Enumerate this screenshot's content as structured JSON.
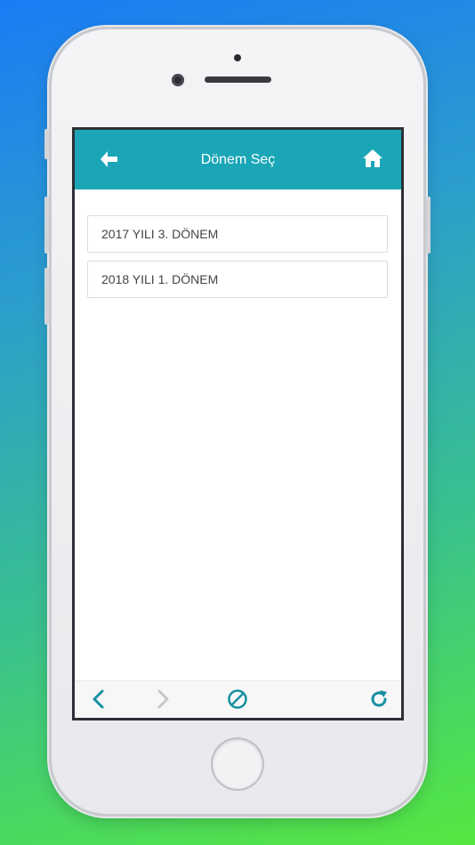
{
  "header": {
    "title": "Dönem Seç",
    "back_icon": "arrow-left-icon",
    "home_icon": "home-icon"
  },
  "periods": [
    {
      "label": "2017 YILI 3. DÖNEM"
    },
    {
      "label": "2018 YILI 1. DÖNEM"
    }
  ],
  "toolbar": {
    "back_icon": "chevron-left-icon",
    "forward_icon": "chevron-right-icon",
    "stop_icon": "stop-icon",
    "reload_icon": "reload-icon"
  },
  "colors": {
    "accent": "#1aa6b7",
    "toolbar_icon": "#16909f",
    "toolbar_icon_disabled": "#c8c8c8"
  }
}
